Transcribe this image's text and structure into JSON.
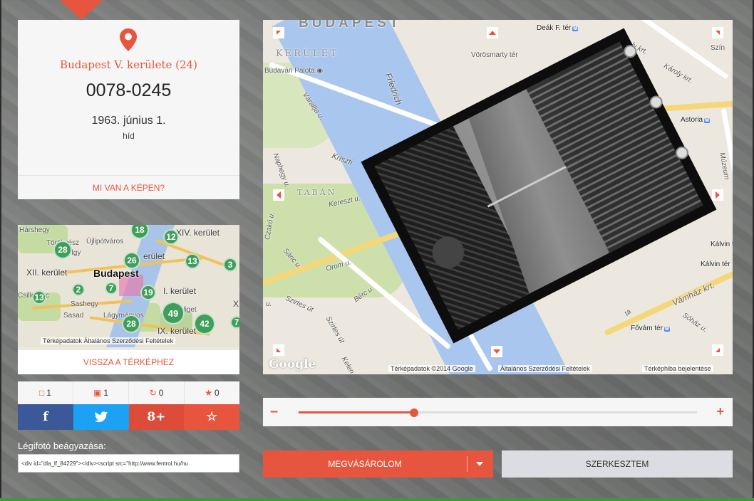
{
  "photo": {
    "district": "Budapest V. kerülete (24)",
    "id": "0078-0245",
    "date": "1963. június 1.",
    "tag": "híd",
    "whats_in_photo": "MI VAN A KÉPEN?"
  },
  "mini_map": {
    "labels": [
      "Hárshegy",
      "Törökvész",
      "Újlipótváros",
      "XIV. kerület",
      "erület",
      "XII. kerület",
      "Budapest",
      "I. kerület",
      "Sashegy",
      "Sasad",
      "Lágymányos",
      "IX. kerület",
      "X.",
      "Csillebérc",
      "Népliget",
      "olgy"
    ],
    "clusters": [
      "18",
      "12",
      "28",
      "26",
      "13",
      "3",
      "2",
      "7",
      "19",
      "13",
      "49",
      "28",
      "42",
      "7"
    ],
    "attribution": "Térképadatok Általános Szerződési Feltételek",
    "back_button": "VISSZA A TÉRKÉPHEZ"
  },
  "stats": {
    "comments": "1",
    "pins": "1",
    "shares": "0",
    "favorites": "0"
  },
  "share": {
    "facebook": "f",
    "twitter": "twitter-bird",
    "googleplus": "g+",
    "favorite": "☆"
  },
  "embed": {
    "label": "Légifotó beágyazása:",
    "code": "<div id=\"dla_lf_84229\"></div><script src=\"http://www.fentrol.hu/hu"
  },
  "main_map": {
    "labels": {
      "budapest": "BUDAPEST",
      "kerulet": "KERÜLET",
      "budavari": "Budavári Palota",
      "deak": "Deák F. tér",
      "vorosmarty": "Vörösmarty tér",
      "karoly1": "Károly krt.",
      "karoly2": "Károly krt.",
      "szin": "Szín",
      "astoria": "Astoria",
      "muzeum": "Múzeum",
      "kalvin": "Kálvin tér",
      "kalvin2": "Kálvin tér",
      "vamhaz": "Vámház krt.",
      "fovam": "Fővám tér",
      "sohaz": "Sóház u.",
      "friedrich": "Friedrich",
      "krisztina": "Kriszti",
      "tabán": "TABÁN",
      "kereszt": "Kereszt u.",
      "varalja": "Várallja u.",
      "naphegy": "Naphegy u.",
      "czako": "Czakó u.",
      "sanc": "Sánc u.",
      "orom": "Orom u.",
      "berc": "Bérc u.",
      "szirtes1": "Szirtes út",
      "szirtes2": "Szirtes út",
      "keleni": "Kelen",
      "vu": "u.",
      "ta": "ta"
    },
    "attribution": {
      "data": "Térképadatok ©2014 Google",
      "terms": "Általános Szerződési Feltételek",
      "report": "Térképhiba bejelentése"
    },
    "google": "Google"
  },
  "opacity_slider": {
    "value": 0.29
  },
  "actions": {
    "buy": "MEGVÁSÁROLOM",
    "edit": "SZERKESZTEM"
  },
  "colors": {
    "accent": "#e8553e",
    "cluster": "#3f9e5a",
    "facebook": "#3b5998",
    "twitter": "#1da1f2",
    "googleplus": "#dd4b39"
  }
}
